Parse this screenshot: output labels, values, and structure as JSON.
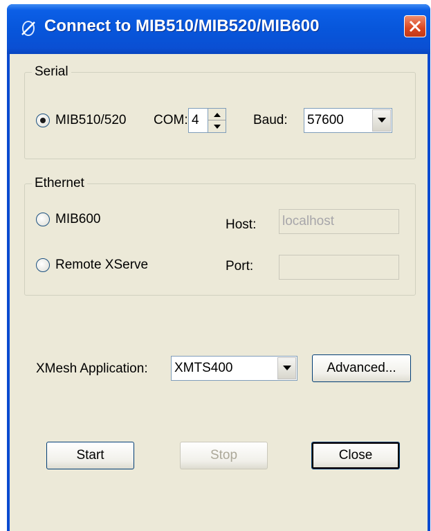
{
  "window": {
    "title": "Connect to MIB510/MIB520/MIB600",
    "icon": "probe-icon",
    "close_icon": "close-icon"
  },
  "serial": {
    "group_label": "Serial",
    "radio_label": "MIB510/520",
    "radio_checked": true,
    "com_label": "COM:",
    "com_value": "4",
    "baud_label": "Baud:",
    "baud_value": "57600"
  },
  "ethernet": {
    "group_label": "Ethernet",
    "mib600_label": "MIB600",
    "mib600_checked": false,
    "remote_label": "Remote XServe",
    "remote_checked": false,
    "host_label": "Host:",
    "host_value": "localhost",
    "port_label": "Port:",
    "port_value": ""
  },
  "xmesh": {
    "label": "XMesh Application:",
    "value": "XMTS400",
    "advanced_label": "Advanced..."
  },
  "buttons": {
    "start": "Start",
    "stop": "Stop",
    "close": "Close"
  },
  "colors": {
    "titlebar": "#0756db",
    "client_bg": "#ece9d8",
    "close_button": "#d9451f"
  }
}
